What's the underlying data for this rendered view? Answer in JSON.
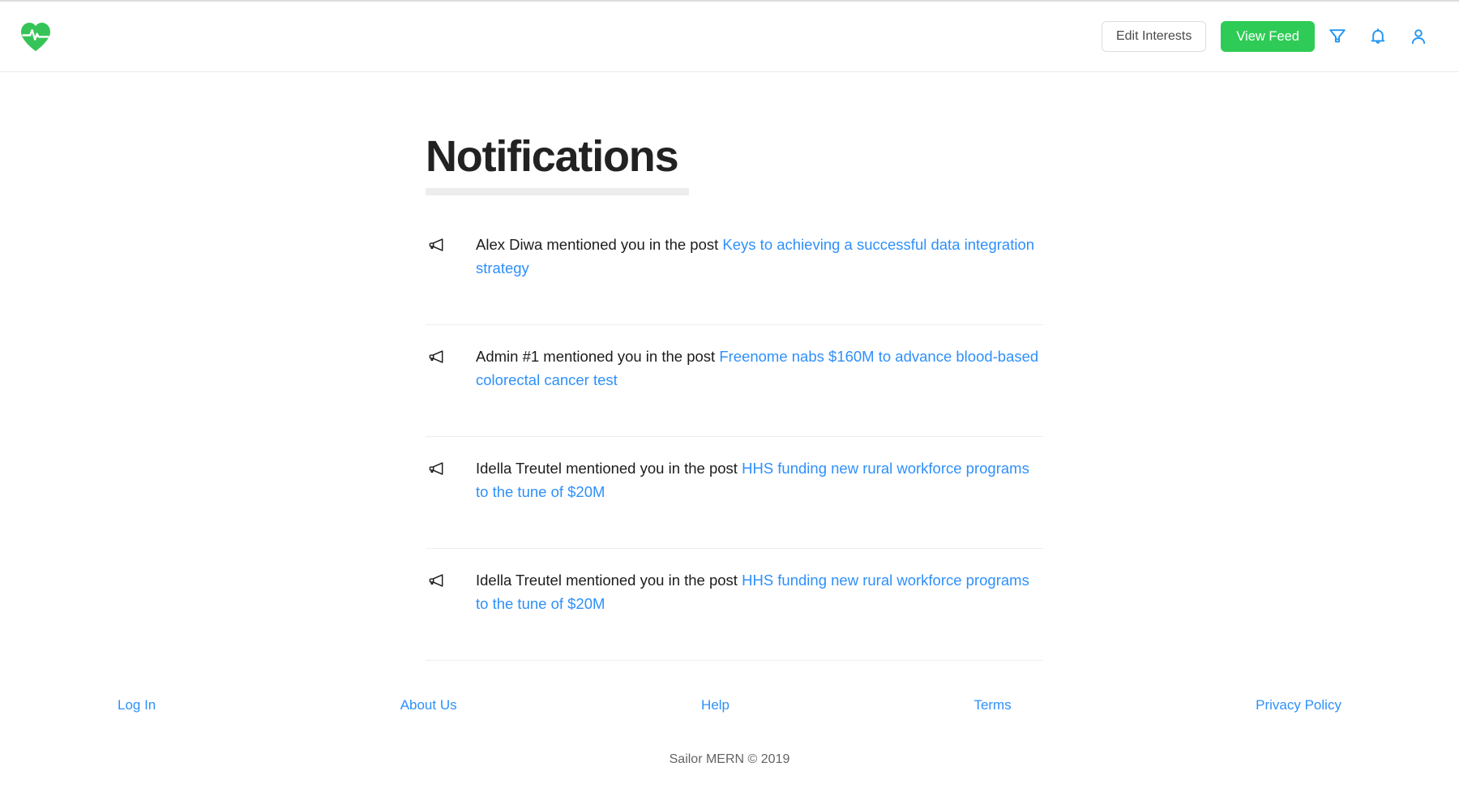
{
  "header": {
    "logo_icon": "heart-pulse-icon",
    "edit_interests_label": "Edit Interests",
    "view_feed_label": "View Feed",
    "filter_icon": "filter-funnel-icon",
    "bell_icon": "bell-icon",
    "account_icon": "user-account-icon",
    "accent_green": "#2ecc56",
    "accent_blue": "#2e90fa"
  },
  "main": {
    "title": "Notifications",
    "notifications": [
      {
        "icon": "megaphone-icon",
        "actor": "Alex Diwa",
        "action": "mentioned you in the post",
        "post_title": "Keys to achieving a successful data integration strategy"
      },
      {
        "icon": "megaphone-icon",
        "actor": "Admin #1",
        "action": "mentioned you in the post",
        "post_title": "Freenome nabs $160M to advance blood-based colorectal cancer test"
      },
      {
        "icon": "megaphone-icon",
        "actor": "Idella Treutel",
        "action": "mentioned you in the post",
        "post_title": "HHS funding new rural workforce programs to the tune of $20M"
      },
      {
        "icon": "megaphone-icon",
        "actor": "Idella Treutel",
        "action": "mentioned you in the post",
        "post_title": "HHS funding new rural workforce programs to the tune of $20M"
      }
    ]
  },
  "footer": {
    "links": [
      {
        "label": "Log In"
      },
      {
        "label": "About Us"
      },
      {
        "label": "Help"
      },
      {
        "label": "Terms"
      },
      {
        "label": "Privacy Policy"
      }
    ],
    "copyright": "Sailor MERN © 2019"
  }
}
